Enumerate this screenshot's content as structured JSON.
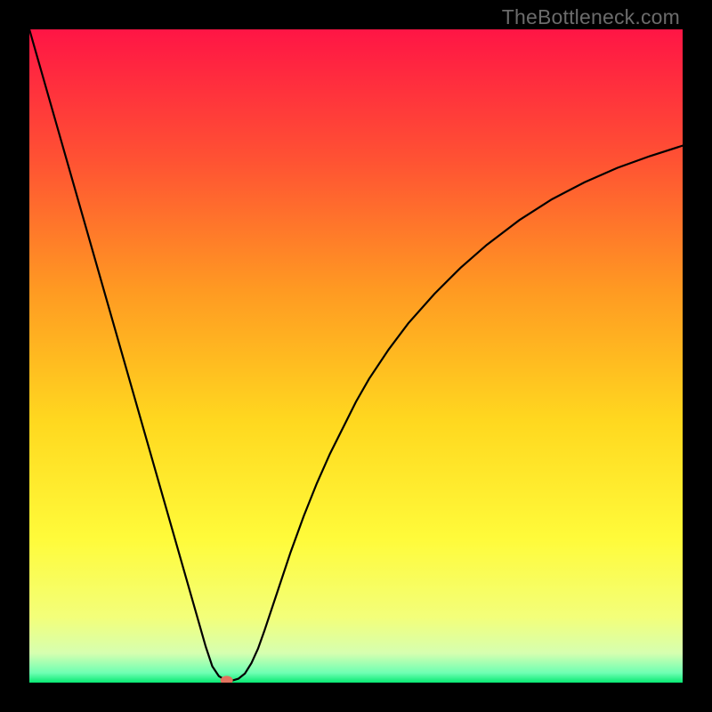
{
  "watermark": "TheBottleneck.com",
  "chart_data": {
    "type": "line",
    "title": "",
    "xlabel": "",
    "ylabel": "",
    "xlim": [
      0,
      100
    ],
    "ylim": [
      0,
      100
    ],
    "grid": false,
    "legend": false,
    "background_gradient": {
      "stops": [
        {
          "offset": 0.0,
          "color": "#ff1545"
        },
        {
          "offset": 0.2,
          "color": "#ff5233"
        },
        {
          "offset": 0.4,
          "color": "#ff9a22"
        },
        {
          "offset": 0.6,
          "color": "#ffd81f"
        },
        {
          "offset": 0.78,
          "color": "#fffb3a"
        },
        {
          "offset": 0.9,
          "color": "#f3ff7a"
        },
        {
          "offset": 0.955,
          "color": "#d6ffb0"
        },
        {
          "offset": 0.985,
          "color": "#6fffb3"
        },
        {
          "offset": 1.0,
          "color": "#08e973"
        }
      ]
    },
    "series": [
      {
        "name": "bottleneck-curve",
        "color": "#000000",
        "width": 2.2,
        "x": [
          0,
          2,
          4,
          6,
          8,
          10,
          12,
          14,
          16,
          18,
          20,
          22,
          24,
          26,
          27,
          28,
          29,
          30,
          31,
          32,
          33,
          34,
          35,
          36,
          38,
          40,
          42,
          44,
          46,
          48,
          50,
          52,
          55,
          58,
          62,
          66,
          70,
          75,
          80,
          85,
          90,
          95,
          100
        ],
        "y": [
          100,
          93,
          86,
          79,
          72,
          65,
          58,
          51,
          44,
          37,
          30,
          23,
          16,
          9,
          5.5,
          2.5,
          1.0,
          0.4,
          0.3,
          0.6,
          1.4,
          3.0,
          5.2,
          8.0,
          14,
          20,
          25.5,
          30.5,
          35,
          39,
          43,
          46.5,
          51,
          55,
          59.5,
          63.5,
          67,
          70.8,
          74,
          76.6,
          78.8,
          80.6,
          82.2
        ]
      }
    ],
    "marker": {
      "name": "optimal-point",
      "x": 30.2,
      "y": 0.35,
      "color": "#e2735f",
      "rx": 7,
      "ry": 5
    }
  }
}
